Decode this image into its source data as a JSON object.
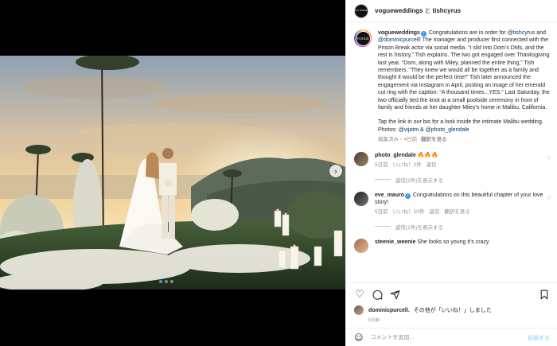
{
  "header": {
    "user1": "vogueweddings",
    "sep": "と",
    "user2": "tishcyrus",
    "logo": "VOGUE WEDDINGS"
  },
  "caption": {
    "username": "vogueweddings",
    "intro": "Congratulations are in order for",
    "mention1": "@tishcyrus",
    "and": "and",
    "mention2": "@dominicpurcell",
    "text1": "! The manager and producer first connected with the Prison Break actor via social media. “I slid into Dom’s DMs, and the rest is history,” Tish explains. The two got engaged over Thanksgiving last year. “Dom, along with Miley, planned the entire thing,” Tish remembers. “They knew we would all be together as a family and thought it would be the perfect time!” Tish later announced the engagement via Instagram in April, posting an image of her emerald cut ring with the caption: “A thousand times...YES.” Last Saturday, the two officially tied the knot at a small poolside ceremony in front of family and friends at her daughter Miley’s home in Malibu, California.",
    "text2": "Tap the link in our bio for a look inside the intimate Malibu wedding. Photos:",
    "photo1": "@vijatm",
    "amp": "&",
    "photo2": "@photo_glendale",
    "edited": "編集済み・4日前",
    "see_translation": "翻訳を見る"
  },
  "comments": [
    {
      "user": "photo_glendale",
      "text": "🔥🔥🔥",
      "time": "5日前",
      "likes": "いいね！2件",
      "reply": "返信",
      "view_replies": "返信(2件)を表示する",
      "avatar_color": "#7a6a55"
    },
    {
      "user": "eve_mauro",
      "text": "Congratulations on this beautiful chapter of your love story!",
      "time": "5日前",
      "likes": "いいね！10件",
      "reply": "返信",
      "translate": "翻訳を見る",
      "view_replies": "返信(1件)を表示する",
      "avatar_color": "#3c3c3c"
    },
    {
      "user": "steenie_weenie",
      "text": "She looks so young it’s crazy",
      "avatar_color": "#c4896b"
    }
  ],
  "likes": {
    "user": "dominicpurcell",
    "rest": "、その他が「いいね！」しました"
  },
  "date": "5日前",
  "comment_box": {
    "placeholder": "コメントを追加...",
    "post": "投稿する"
  },
  "colors": {
    "accent": "#3897f0",
    "link": "#00376b"
  }
}
